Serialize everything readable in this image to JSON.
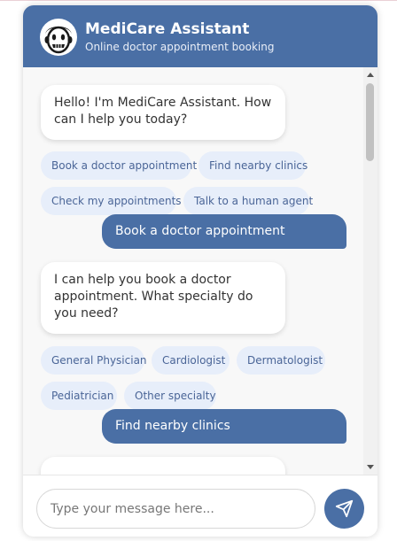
{
  "header": {
    "title": "MediCare Assistant",
    "subtitle": "Online doctor appointment booking",
    "avatar_icon": "doctor-face-icon"
  },
  "messages": [
    {
      "sender": "bot",
      "text": "Hello! I'm MediCare Assistant. How can I help you today?",
      "options": [
        "Book a doctor appointment",
        "Find nearby clinics",
        "Check my appointments",
        "Talk to a human agent"
      ]
    },
    {
      "sender": "user",
      "text": "Book a doctor appointment"
    },
    {
      "sender": "bot",
      "text": "I can help you book a doctor appointment. What specialty do you need?",
      "options": [
        "General Physician",
        "Cardiologist",
        "Dermatologist",
        "Pediatrician",
        "Other specialty"
      ]
    },
    {
      "sender": "user",
      "text": "Find nearby clinics"
    }
  ],
  "input": {
    "value": "",
    "placeholder": "Type your message here..."
  },
  "send_icon": "paper-plane-icon",
  "colors": {
    "brand": "#4a6fa5",
    "chip_bg": "#e7eefa",
    "chip_text": "#4a6597",
    "panel_bg": "#f8f8f8"
  }
}
